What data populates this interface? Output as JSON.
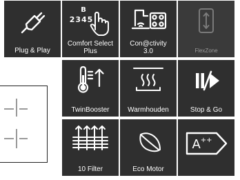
{
  "tiles": {
    "plug_play": {
      "label": "Plug & Play",
      "icon": "plug-icon"
    },
    "comfort_select": {
      "label_line1": "Comfort Select",
      "label_line2": "Plus",
      "icon": "hand-touch-icon",
      "digits_top": "B",
      "digits": "2345"
    },
    "connectivity": {
      "label_line1": "Con@ctivity",
      "label_line2": "3.0",
      "icon": "hood-stove-icon"
    },
    "flexzone": {
      "label": "FlexZone",
      "icon": "flexzone-icon"
    },
    "twinbooster": {
      "label": "TwinBooster",
      "icon": "thermometer-icon"
    },
    "warmhouden": {
      "label": "Warmhouden",
      "icon": "steam-pan-icon"
    },
    "stop_go": {
      "label": "Stop & Go",
      "icon": "pause-play-icon"
    },
    "filter": {
      "label": "10 Filter",
      "icon": "filter-layers-icon"
    },
    "eco_motor": {
      "label": "Eco Motor",
      "icon": "leaf-icon"
    },
    "energy": {
      "label": "A++",
      "icon": "energy-label-icon"
    }
  },
  "colors": {
    "tile_background": "#2f2f2f",
    "tile_text": "#ffffff",
    "muted_text": "#9a9a9a"
  }
}
